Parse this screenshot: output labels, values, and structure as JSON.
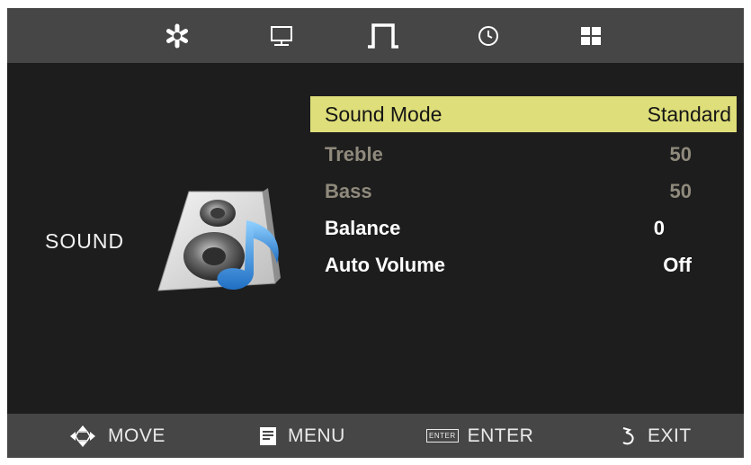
{
  "tabs": [
    {
      "name": "picture",
      "icon": "asterisk-icon",
      "selected": false
    },
    {
      "name": "screen",
      "icon": "monitor-icon",
      "selected": false
    },
    {
      "name": "sound",
      "icon": "music-note-icon",
      "selected": true
    },
    {
      "name": "time",
      "icon": "clock-icon",
      "selected": false
    },
    {
      "name": "option",
      "icon": "grid-icon",
      "selected": false
    }
  ],
  "section": {
    "label": "SOUND",
    "icon": "speaker-music-icon"
  },
  "menu": [
    {
      "label": "Sound Mode",
      "value": "Standard",
      "state": "selected"
    },
    {
      "label": "Treble",
      "value": "50",
      "state": "disabled"
    },
    {
      "label": "Bass",
      "value": "50",
      "state": "disabled"
    },
    {
      "label": "Balance",
      "value": "0",
      "state": "active"
    },
    {
      "label": "Auto Volume",
      "value": "Off",
      "state": "active"
    }
  ],
  "footer": {
    "move": {
      "label": "MOVE",
      "icon": "move-arrows-icon"
    },
    "menu": {
      "label": "MENU",
      "icon": "menu-icon"
    },
    "enter": {
      "label": "ENTER",
      "icon_text": "ENTER"
    },
    "exit": {
      "label": "EXIT",
      "icon": "return-icon"
    }
  },
  "colors": {
    "highlight": "#dede7a",
    "background": "#1d1d1d",
    "bar": "#464646",
    "disabled_text": "#8f8a7c"
  }
}
